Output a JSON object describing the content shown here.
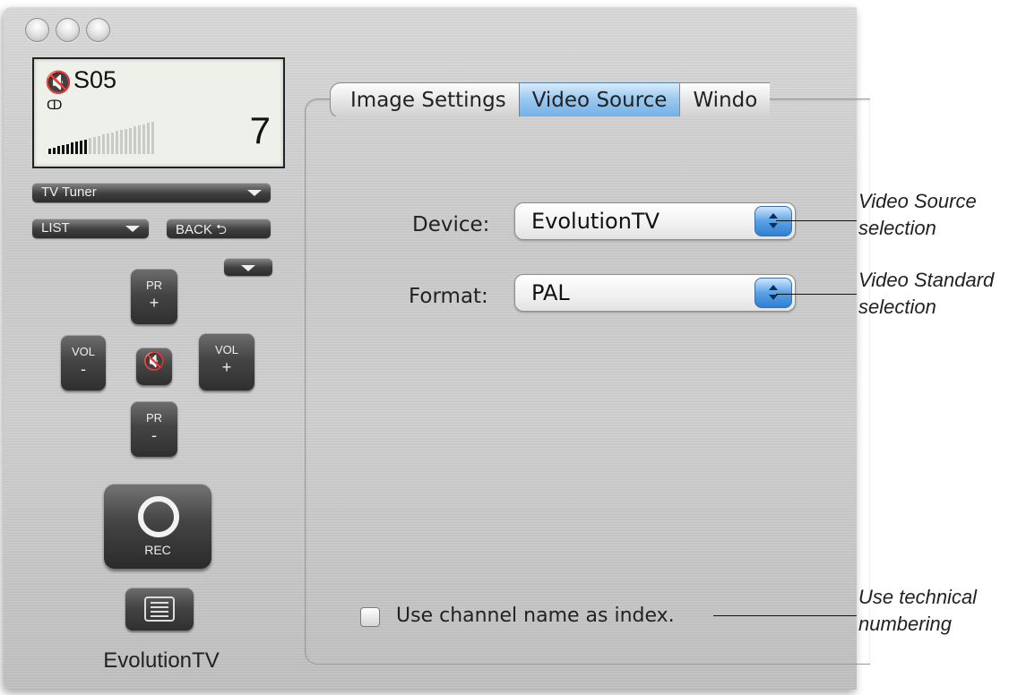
{
  "display": {
    "channel": "S05",
    "stereo_symbol": "ↀ",
    "channel_number": "7",
    "signal_bars_filled": 9,
    "signal_bars_total": 24
  },
  "remote": {
    "source_menu": "TV Tuner",
    "list_label": "LIST",
    "back_label": "BACK ⮌",
    "pr_plus": {
      "top": "PR",
      "bottom": "+"
    },
    "pr_minus": {
      "top": "PR",
      "bottom": "-"
    },
    "vol_minus": {
      "top": "VOL",
      "bottom": "-"
    },
    "vol_plus": {
      "top": "VOL",
      "bottom": "+"
    },
    "rec_label": "REC",
    "app_name": "EvolutionTV"
  },
  "tabs": [
    {
      "label": "Image Settings",
      "active": false
    },
    {
      "label": "Video Source",
      "active": true
    },
    {
      "label": "Windo",
      "active": false
    }
  ],
  "form": {
    "device_label": "Device:",
    "device_value": "EvolutionTV",
    "format_label": "Format:",
    "format_value": "PAL",
    "checkbox_label": "Use channel name as index.",
    "checkbox_checked": false
  },
  "annotations": {
    "video_source": [
      "Video Source",
      "selection"
    ],
    "video_standard": [
      "Video Standard",
      "selection"
    ],
    "technical_numbering": [
      "Use technical",
      "numbering"
    ]
  }
}
